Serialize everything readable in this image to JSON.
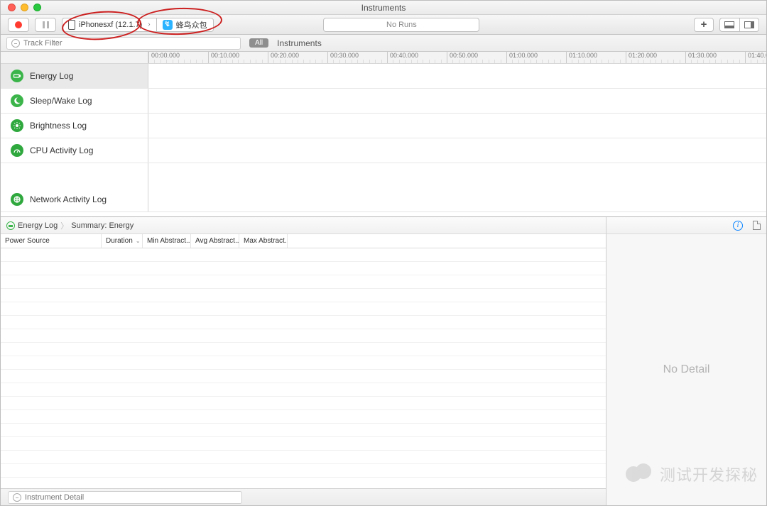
{
  "window": {
    "title": "Instruments"
  },
  "toolbar": {
    "device": "iPhonesxf (12.1.7)",
    "process": "蜂鸟众包",
    "runs_field": "No Runs"
  },
  "filterbar": {
    "track_placeholder": "Track Filter",
    "all_label": "All",
    "section_label": "Instruments"
  },
  "timeline": {
    "ticks": [
      "00:00.000",
      "00:10.000",
      "00:20.000",
      "00:30.000",
      "00:40.000",
      "00:50.000",
      "01:00.000",
      "01:10.000",
      "01:20.000",
      "01:30.000",
      "01:40.000"
    ]
  },
  "tracks": [
    {
      "name": "Energy Log",
      "icon": "battery",
      "selected": true
    },
    {
      "name": "Sleep/Wake Log",
      "icon": "moon",
      "selected": false
    },
    {
      "name": "Brightness Log",
      "icon": "sun",
      "selected": false
    },
    {
      "name": "CPU Activity Log",
      "icon": "gauge",
      "selected": false
    },
    {
      "name": "Network Activity Log",
      "icon": "net",
      "selected": false
    }
  ],
  "breadcrumb": {
    "root": "Energy Log",
    "leaf": "Summary: Energy"
  },
  "detail_table": {
    "columns": [
      {
        "label": "Power Source",
        "width": 142
      },
      {
        "label": "Duration",
        "width": 58,
        "sorted": true
      },
      {
        "label": "Min Abstract...",
        "width": 68
      },
      {
        "label": "Avg Abstract...",
        "width": 68
      },
      {
        "label": "Max Abstract...",
        "width": 68
      }
    ],
    "rows": []
  },
  "detail_panel": {
    "empty_text": "No Detail"
  },
  "bottombar": {
    "instrument_detail_placeholder": "Instrument Detail"
  },
  "watermark": "测试开发探秘"
}
